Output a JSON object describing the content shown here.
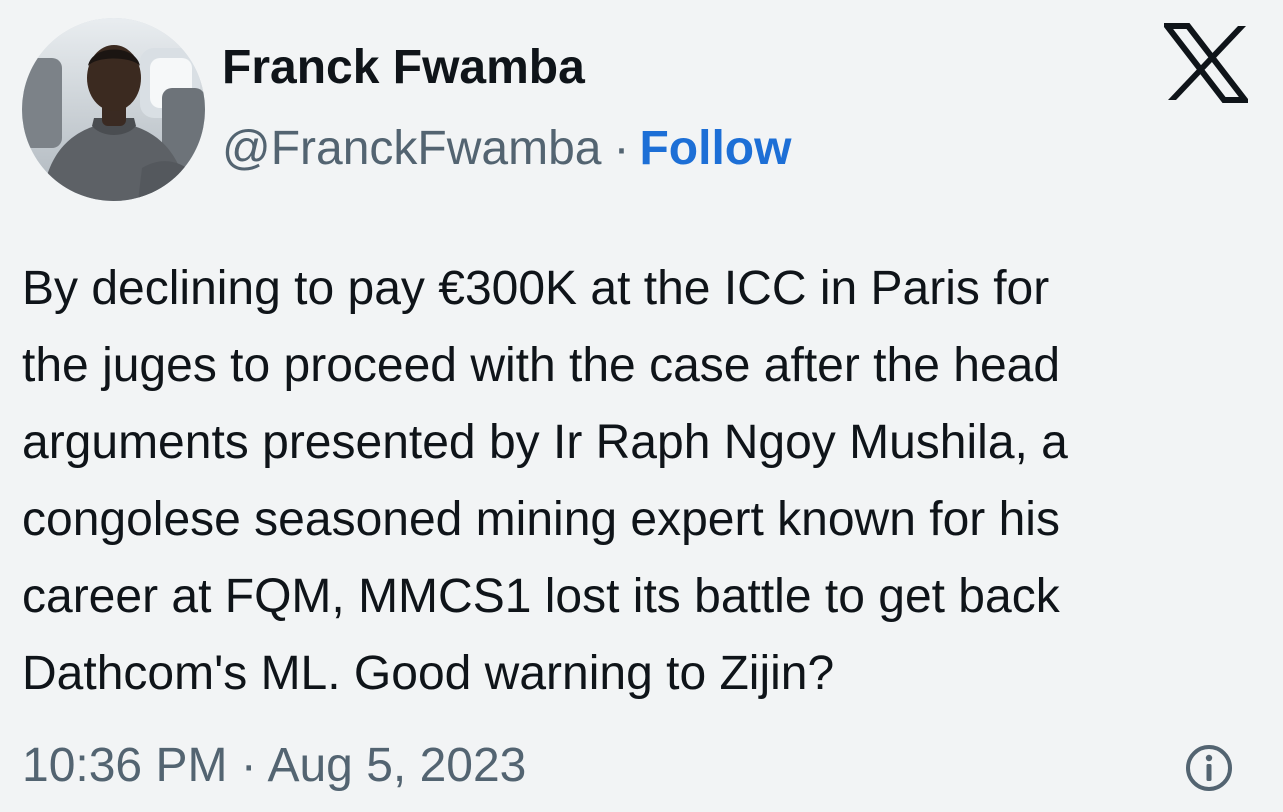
{
  "tweet": {
    "author": {
      "display_name": "Franck Fwamba",
      "handle": "@FranckFwamba",
      "separator": "·",
      "follow_label": "Follow",
      "avatar_icon": "profile-photo-avatar"
    },
    "text": "By declining to pay €300K at the ICC in Paris for\nthe juges to proceed with the case after the head\narguments presented by Ir Raph Ngoy Mushila, a\ncongolese seasoned mining expert known for his\ncareer at FQM, MMCS1 lost its battle to get back\nDathcom's ML. Good warning to Zijin?",
    "timestamp": "10:36 PM · Aug 5, 2023",
    "icons": {
      "logo": "x-logo-icon",
      "info": "info-icon"
    }
  },
  "colors": {
    "background": "#f2f4f5",
    "text_primary": "#0f1419",
    "text_secondary": "#536471",
    "follow_link": "#1d6fd6"
  }
}
